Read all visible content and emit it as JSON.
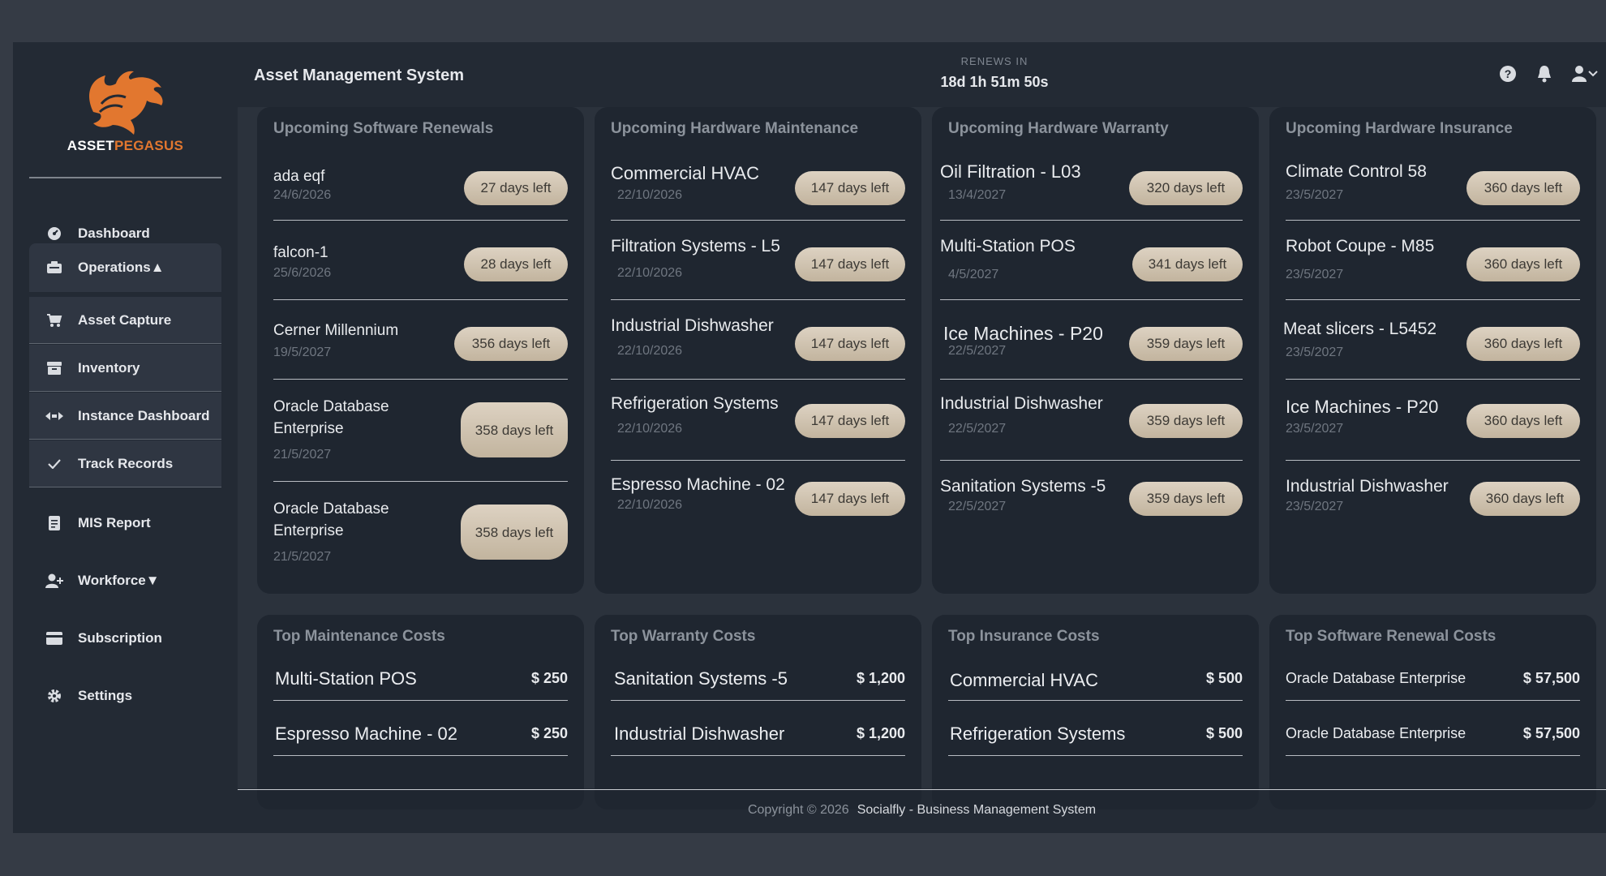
{
  "brand": {
    "name_part1": "ASSET",
    "name_part2": "PEGASUS",
    "accent": "#e2772f"
  },
  "header": {
    "title": "Asset Management System",
    "renews_label": "RENEWS IN",
    "renews_value": "18d 1h 51m 50s",
    "icons": [
      "help-icon",
      "bell-icon",
      "user-icon"
    ]
  },
  "sidebar": {
    "dashboard": "Dashboard",
    "operations": "Operations▲",
    "asset_capture": "Asset Capture",
    "inventory": "Inventory",
    "instance_dashboard": "Instance Dashboard",
    "track_records": "Track Records",
    "mis_report": "MIS Report",
    "workforce": "Workforce▼",
    "subscription": "Subscription",
    "settings": "Settings"
  },
  "upcoming": {
    "software": {
      "title": "Upcoming Software Renewals",
      "items": [
        {
          "name": "ada eqf",
          "date": "24/6/2026",
          "days": "27 days left"
        },
        {
          "name": "falcon-1",
          "date": "25/6/2026",
          "days": "28 days left"
        },
        {
          "name": "Cerner Millennium",
          "date": "19/5/2027",
          "days": "356 days left"
        },
        {
          "name": "Oracle Database Enterprise",
          "date": "21/5/2027",
          "days": "358 days left"
        },
        {
          "name": "Oracle Database Enterprise",
          "date": "21/5/2027",
          "days": "358 days left"
        }
      ]
    },
    "maintenance": {
      "title": "Upcoming Hardware Maintenance",
      "items": [
        {
          "name": "Commercial HVAC",
          "date": "22/10/2026",
          "days": "147 days left"
        },
        {
          "name": "Filtration Systems - L5",
          "date": "22/10/2026",
          "days": "147 days left"
        },
        {
          "name": "Industrial Dishwasher",
          "date": "22/10/2026",
          "days": "147 days left"
        },
        {
          "name": "Refrigeration Systems",
          "date": "22/10/2026",
          "days": "147 days left"
        },
        {
          "name": "Espresso Machine - 02",
          "date": "22/10/2026",
          "days": "147 days left"
        }
      ]
    },
    "warranty": {
      "title": "Upcoming Hardware Warranty",
      "items": [
        {
          "name": "Oil Filtration  - L03",
          "date": "13/4/2027",
          "days": "320 days left"
        },
        {
          "name": "Multi-Station POS",
          "date": "4/5/2027",
          "days": "341 days left"
        },
        {
          "name": "Ice Machines - P20",
          "date": "22/5/2027",
          "days": "359 days left"
        },
        {
          "name": "Industrial Dishwasher",
          "date": "22/5/2027",
          "days": "359 days left"
        },
        {
          "name": "Sanitation Systems -5",
          "date": "22/5/2027",
          "days": "359 days left"
        }
      ]
    },
    "insurance": {
      "title": "Upcoming Hardware Insurance",
      "items": [
        {
          "name": "Climate Control 58",
          "date": "23/5/2027",
          "days": "360 days left"
        },
        {
          "name": "Robot Coupe - M85",
          "date": "23/5/2027",
          "days": "360 days left"
        },
        {
          "name": "Meat slicers - L5452",
          "date": "23/5/2027",
          "days": "360 days left"
        },
        {
          "name": "Ice Machines - P20",
          "date": "23/5/2027",
          "days": "360 days left"
        },
        {
          "name": "Industrial Dishwasher",
          "date": "23/5/2027",
          "days": "360 days left"
        }
      ]
    }
  },
  "costs": {
    "maintenance": {
      "title": "Top Maintenance Costs",
      "items": [
        {
          "name": "Multi-Station POS",
          "amount": "$ 250"
        },
        {
          "name": "Espresso Machine - 02",
          "amount": "$ 250"
        }
      ]
    },
    "warranty": {
      "title": "Top Warranty Costs",
      "items": [
        {
          "name": "Sanitation Systems -5",
          "amount": "$ 1,200"
        },
        {
          "name": "Industrial Dishwasher",
          "amount": "$ 1,200"
        }
      ]
    },
    "insurance": {
      "title": "Top Insurance Costs",
      "items": [
        {
          "name": "Commercial HVAC",
          "amount": "$ 500"
        },
        {
          "name": "Refrigeration Systems",
          "amount": "$ 500"
        }
      ]
    },
    "software": {
      "title": "Top Software Renewal Costs",
      "items": [
        {
          "name": "Oracle Database Enterprise",
          "amount": "$ 57,500"
        },
        {
          "name": "Oracle Database Enterprise",
          "amount": "$ 57,500"
        }
      ]
    }
  },
  "footer": {
    "copyright": "Copyright © 2026",
    "company": "Socialfly - Business Management System"
  }
}
